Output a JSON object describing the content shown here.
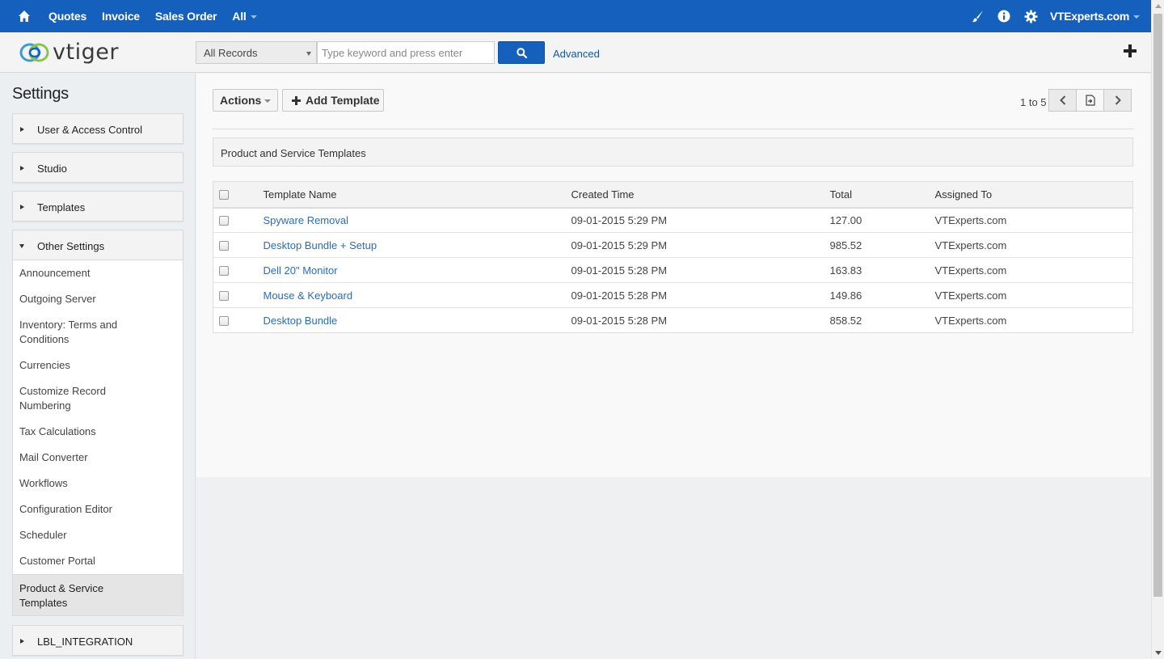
{
  "topnav": {
    "items": [
      "Quotes",
      "Invoice",
      "Sales Order",
      "All"
    ],
    "user": "VTExperts.com",
    "icons": [
      "home-icon",
      "brush-icon",
      "info-icon",
      "gear-icon",
      "chevron-down-icon"
    ]
  },
  "header": {
    "logo_text": "vtiger",
    "search_scope": "All Records",
    "search_placeholder": "Type keyword and press enter",
    "search_value": "",
    "advanced_label": "Advanced"
  },
  "sidebar": {
    "title": "Settings",
    "blocks": [
      "User & Access Control",
      "Studio",
      "Templates",
      "Other Settings"
    ],
    "other_settings_items": [
      "Announcement",
      "Outgoing Server",
      "Inventory: Terms and Conditions",
      "Currencies",
      "Customize Record Numbering",
      "Tax Calculations",
      "Mail Converter",
      "Workflows",
      "Configuration Editor",
      "Scheduler",
      "Customer Portal"
    ],
    "active_item": "Product & Service Templates",
    "integration_block": "LBL_INTEGRATION"
  },
  "toolbar": {
    "actions_label": "Actions",
    "add_label": "Add Template",
    "pager_text": "1 to 5"
  },
  "section_title": "Product and Service Templates",
  "table": {
    "columns": [
      "Template Name",
      "Created Time",
      "Total",
      "Assigned To"
    ],
    "rows": [
      {
        "name": "Spyware Removal",
        "created": "09-01-2015 5:29 PM",
        "total": "127.00",
        "assigned": "VTExperts.com"
      },
      {
        "name": "Desktop Bundle + Setup",
        "created": "09-01-2015 5:29 PM",
        "total": "985.52",
        "assigned": "VTExperts.com"
      },
      {
        "name": "Dell 20\" Monitor",
        "created": "09-01-2015 5:28 PM",
        "total": "163.83",
        "assigned": "VTExperts.com"
      },
      {
        "name": "Mouse & Keyboard",
        "created": "09-01-2015 5:28 PM",
        "total": "149.86",
        "assigned": "VTExperts.com"
      },
      {
        "name": "Desktop Bundle",
        "created": "09-01-2015 5:28 PM",
        "total": "858.52",
        "assigned": "VTExperts.com"
      }
    ]
  },
  "colors": {
    "brand_blue": "#1560bd",
    "link": "#2a6cb7"
  }
}
